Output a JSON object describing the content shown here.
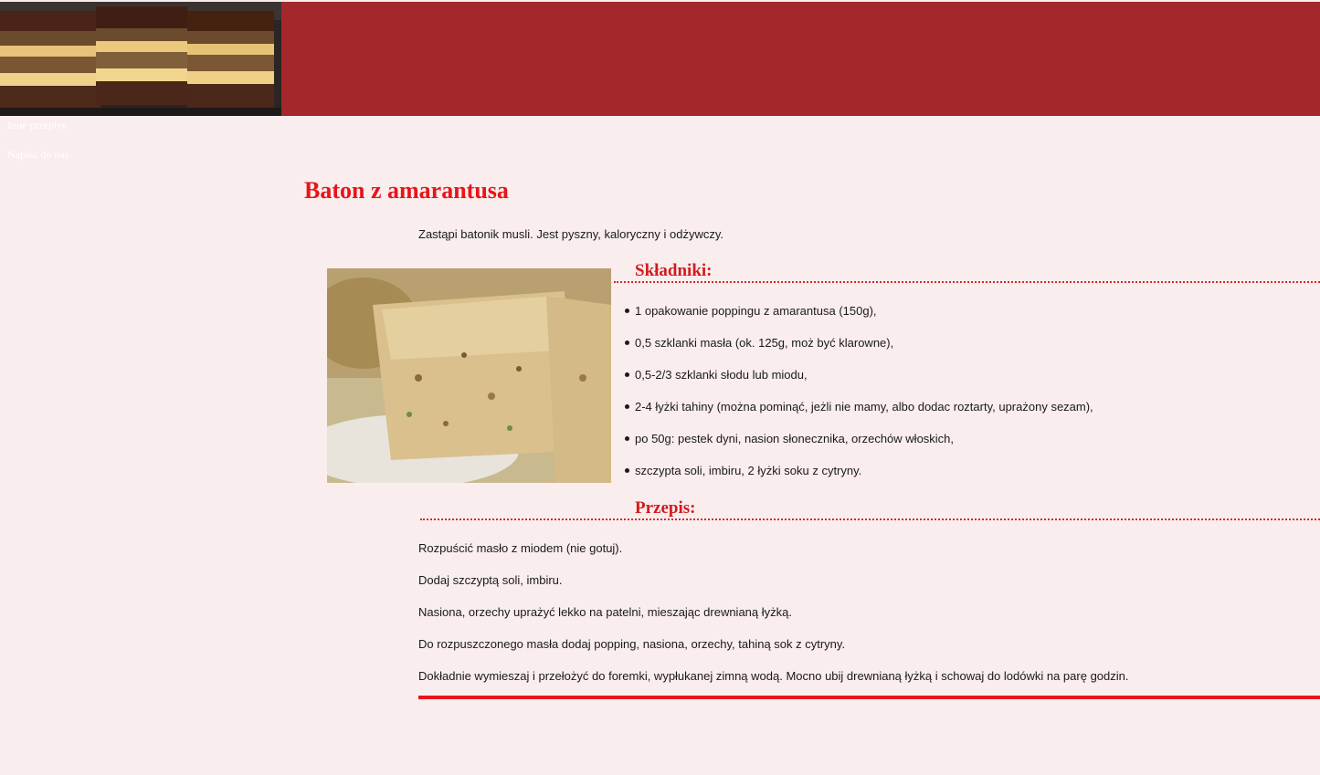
{
  "nav": {
    "items": [
      {
        "label": "Inne przepisy"
      },
      {
        "label": "Napisz do nas"
      }
    ]
  },
  "recipe": {
    "title": "Baton z amarantusa",
    "intro": "Zastąpi batonik musli. Jest pyszny, kaloryczny i odżywczy.",
    "ingredients_heading": "Składniki:",
    "ingredients": [
      "1 opakowanie poppingu z amarantusa (150g),",
      "0,5 szklanki masła (ok. 125g, moż być klarowne),",
      "0,5-2/3 szklanki słodu lub miodu,",
      "2-4 łyżki tahiny (można pominąć, jeżli nie mamy, albo dodac roztarty, uprażony sezam),",
      "po 50g: pestek dyni, nasion słonecznika, orzechów włoskich,",
      "szczypta soli, imbiru, 2 łyżki soku z cytryny."
    ],
    "steps_heading": "Przepis:",
    "steps": [
      "Rozpuścić masło z miodem (nie gotuj).",
      "Dodaj szczyptą soli, imbiru.",
      "Nasiona, orzechy uprażyć lekko na patelni, mieszając drewnianą łyżką.",
      "Do rozpuszczonego masła dodaj popping, nasiona, orzechy, tahiną sok z cytryny.",
      "Dokładnie wymieszaj i przełożyć do foremki, wypłukanej zimną wodą. Mocno ubij drewnianą łyżką i schowaj do lodówki na parę godzin."
    ]
  },
  "colors": {
    "header_bar": "#a4282b",
    "page_background": "#f9eded",
    "accent_red": "#e8141a"
  }
}
